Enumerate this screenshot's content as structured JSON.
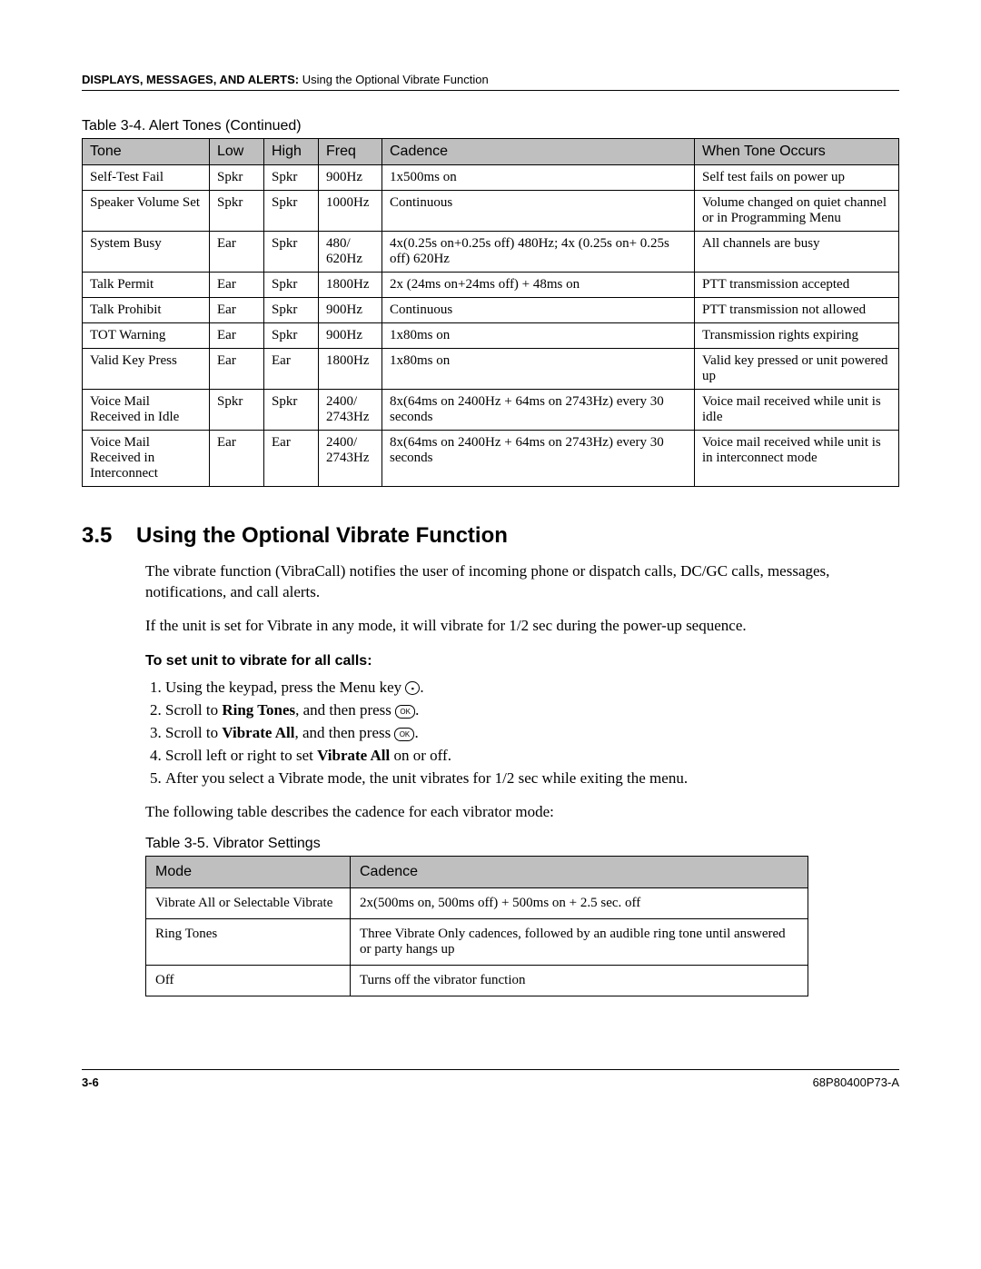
{
  "header": {
    "bold": "DISPLAYS, MESSAGES, AND ALERTS:",
    "rest": " Using the Optional Vibrate Function"
  },
  "table34": {
    "caption": "Table 3-4. Alert Tones (Continued)",
    "headers": [
      "Tone",
      "Low",
      "High",
      "Freq",
      "Cadence",
      "When Tone Occurs"
    ],
    "rows": [
      [
        "Self-Test Fail",
        "Spkr",
        "Spkr",
        "900Hz",
        "1x500ms on",
        "Self test fails on power up"
      ],
      [
        "Speaker Volume Set",
        "Spkr",
        "Spkr",
        "1000Hz",
        "Continuous",
        "Volume changed on quiet channel or in Programming Menu"
      ],
      [
        "System Busy",
        "Ear",
        "Spkr",
        "480/ 620Hz",
        "4x(0.25s on+0.25s off) 480Hz; 4x (0.25s on+ 0.25s off) 620Hz",
        "All channels are busy"
      ],
      [
        "Talk Permit",
        "Ear",
        "Spkr",
        "1800Hz",
        "2x (24ms on+24ms off) + 48ms on",
        "PTT transmission accepted"
      ],
      [
        "Talk Prohibit",
        "Ear",
        "Spkr",
        "900Hz",
        "Continuous",
        "PTT transmission not allowed"
      ],
      [
        "TOT Warning",
        "Ear",
        "Spkr",
        "900Hz",
        "1x80ms on",
        "Transmission rights expiring"
      ],
      [
        "Valid Key Press",
        "Ear",
        "Ear",
        "1800Hz",
        "1x80ms on",
        "Valid key pressed or unit powered up"
      ],
      [
        "Voice Mail Received in Idle",
        "Spkr",
        "Spkr",
        "2400/ 2743Hz",
        "8x(64ms on 2400Hz + 64ms on 2743Hz) every 30 seconds",
        "Voice mail received while unit is idle"
      ],
      [
        "Voice Mail Received in Interconnect",
        "Ear",
        "Ear",
        "2400/ 2743Hz",
        "8x(64ms on 2400Hz + 64ms on 2743Hz) every 30 seconds",
        "Voice mail received while unit is in interconnect mode"
      ]
    ]
  },
  "section": {
    "number": "3.5",
    "title": "Using the Optional Vibrate Function",
    "p1": "The vibrate function (VibraCall) notifies the user of incoming phone or dispatch calls, DC/GC calls, messages, notifications, and call alerts.",
    "p2": "If the unit is set for Vibrate in any mode, it will vibrate for 1/2 sec during the power-up sequence.",
    "subhead": "To set unit to vibrate for all calls:",
    "steps": {
      "s1a": "Using the keypad, press the Menu key ",
      "s1b": ".",
      "s2a": "Scroll to ",
      "s2b": "Ring Tones",
      "s2c": ", and then press ",
      "s2d": ".",
      "s3a": "Scroll to ",
      "s3b": "Vibrate All",
      "s3c": ", and then press ",
      "s3d": ".",
      "s4a": "Scroll left or right to set ",
      "s4b": "Vibrate All",
      "s4c": " on or off.",
      "s5": "After you select a Vibrate mode, the unit vibrates for 1/2 sec while exiting the menu."
    },
    "p3": "The following table describes the cadence for each vibrator mode:"
  },
  "table35": {
    "caption": "Table 3-5. Vibrator Settings",
    "headers": [
      "Mode",
      "Cadence"
    ],
    "rows": [
      [
        "Vibrate All or Selectable Vibrate",
        "2x(500ms on, 500ms off) + 500ms on + 2.5 sec. off"
      ],
      [
        "Ring Tones",
        "Three Vibrate Only cadences, followed by an audible ring tone until answered or party hangs up"
      ],
      [
        "Off",
        "Turns off the vibrator function"
      ]
    ]
  },
  "footer": {
    "left": "3-6",
    "right": "68P80400P73-A"
  },
  "icons": {
    "menu": "▪",
    "ok": "OK"
  }
}
